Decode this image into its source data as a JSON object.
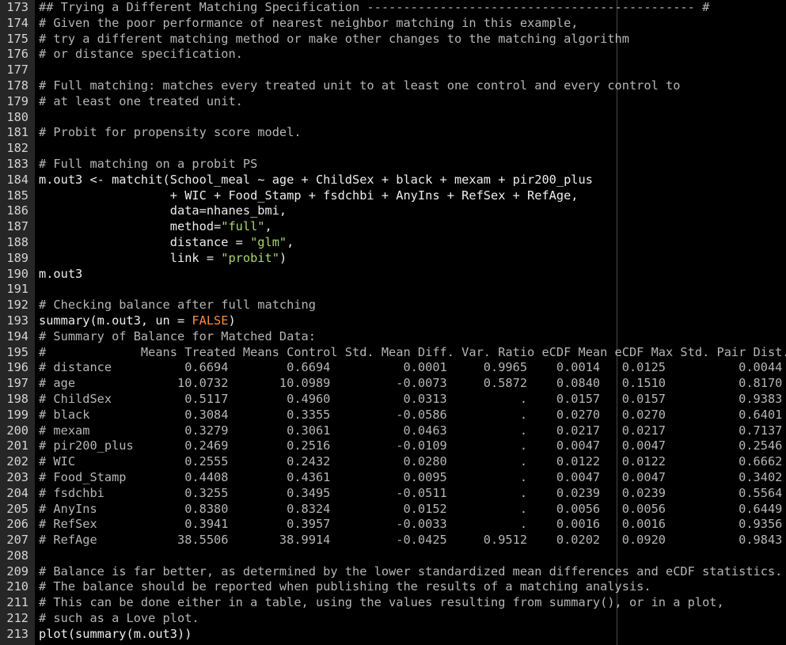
{
  "editor": {
    "colors": {
      "background": "#000000",
      "gutter": "#262626",
      "comment": "#b5b5b5",
      "string": "#a8d86e",
      "constant": "#ff8a3d",
      "text": "#ececec"
    },
    "lines": [
      {
        "n": "173",
        "segments": [
          {
            "t": "## Trying a Different Matching Specification --------------------------------------------- #",
            "c": "cmt"
          }
        ]
      },
      {
        "n": "174",
        "segments": [
          {
            "t": "# Given the poor performance of nearest neighbor matching in this example,",
            "c": "cmt"
          }
        ]
      },
      {
        "n": "175",
        "segments": [
          {
            "t": "# try a different matching method or make other changes to the matching algorithm",
            "c": "cmt"
          }
        ]
      },
      {
        "n": "176",
        "segments": [
          {
            "t": "# or distance specification.",
            "c": "cmt"
          }
        ]
      },
      {
        "n": "177",
        "segments": []
      },
      {
        "n": "178",
        "segments": [
          {
            "t": "# Full matching: matches every treated unit to at least one control and every control to",
            "c": "cmt"
          }
        ]
      },
      {
        "n": "179",
        "segments": [
          {
            "t": "# at least one treated unit.",
            "c": "cmt"
          }
        ]
      },
      {
        "n": "180",
        "segments": []
      },
      {
        "n": "181",
        "segments": [
          {
            "t": "# Probit for propensity score model.",
            "c": "cmt"
          }
        ]
      },
      {
        "n": "182",
        "segments": []
      },
      {
        "n": "183",
        "segments": [
          {
            "t": "# Full matching on a probit PS",
            "c": "cmt"
          }
        ]
      },
      {
        "n": "184",
        "segments": [
          {
            "t": "m.out3 <- matchit(School_meal ~ age + ChildSex + black + mexam + pir200_plus",
            "c": "txt"
          }
        ]
      },
      {
        "n": "185",
        "segments": [
          {
            "t": "                  + WIC + Food_Stamp + fsdchbi + AnyIns + RefSex + RefAge,",
            "c": "txt"
          }
        ]
      },
      {
        "n": "186",
        "segments": [
          {
            "t": "                  data=nhanes_bmi,",
            "c": "txt"
          }
        ]
      },
      {
        "n": "187",
        "segments": [
          {
            "t": "                  method=",
            "c": "txt"
          },
          {
            "t": "\"full\"",
            "c": "str"
          },
          {
            "t": ",",
            "c": "txt"
          }
        ]
      },
      {
        "n": "188",
        "segments": [
          {
            "t": "                  distance = ",
            "c": "txt"
          },
          {
            "t": "\"glm\"",
            "c": "str"
          },
          {
            "t": ",",
            "c": "txt"
          }
        ]
      },
      {
        "n": "189",
        "segments": [
          {
            "t": "                  link = ",
            "c": "txt"
          },
          {
            "t": "\"probit\"",
            "c": "str"
          },
          {
            "t": ")",
            "c": "txt"
          }
        ]
      },
      {
        "n": "190",
        "segments": [
          {
            "t": "m.out3",
            "c": "txt"
          }
        ]
      },
      {
        "n": "191",
        "segments": []
      },
      {
        "n": "192",
        "segments": [
          {
            "t": "# Checking balance after full matching",
            "c": "cmt"
          }
        ]
      },
      {
        "n": "193",
        "segments": [
          {
            "t": "summary(m.out3, un = ",
            "c": "txt"
          },
          {
            "t": "FALSE",
            "c": "kw"
          },
          {
            "t": ")",
            "c": "txt"
          }
        ]
      },
      {
        "n": "194",
        "segments": [
          {
            "t": "# Summary of Balance for Matched Data:",
            "c": "cmt"
          }
        ]
      },
      {
        "n": "195",
        "segments": [
          {
            "t": "#             Means Treated Means Control Std. Mean Diff. Var. Ratio eCDF Mean eCDF Max Std. Pair Dist.",
            "c": "cmt"
          }
        ]
      },
      {
        "n": "196",
        "segments": [
          {
            "t": "# distance          0.6694        0.6694          0.0001     0.9965    0.0014   0.0125          0.0044",
            "c": "cmt"
          }
        ]
      },
      {
        "n": "197",
        "segments": [
          {
            "t": "# age              10.0732       10.0989         -0.0073     0.5872    0.0840   0.1510          0.8170",
            "c": "cmt"
          }
        ]
      },
      {
        "n": "198",
        "segments": [
          {
            "t": "# ChildSex          0.5117        0.4960          0.0313          .    0.0157   0.0157          0.9383",
            "c": "cmt"
          }
        ]
      },
      {
        "n": "199",
        "segments": [
          {
            "t": "# black             0.3084        0.3355         -0.0586          .    0.0270   0.0270          0.6401",
            "c": "cmt"
          }
        ]
      },
      {
        "n": "200",
        "segments": [
          {
            "t": "# mexam             0.3279        0.3061          0.0463          .    0.0217   0.0217          0.7137",
            "c": "cmt"
          }
        ]
      },
      {
        "n": "201",
        "segments": [
          {
            "t": "# pir200_plus       0.2469        0.2516         -0.0109          .    0.0047   0.0047          0.2546",
            "c": "cmt"
          }
        ]
      },
      {
        "n": "202",
        "segments": [
          {
            "t": "# WIC               0.2555        0.2432          0.0280          .    0.0122   0.0122          0.6662",
            "c": "cmt"
          }
        ]
      },
      {
        "n": "203",
        "segments": [
          {
            "t": "# Food_Stamp        0.4408        0.4361          0.0095          .    0.0047   0.0047          0.3402",
            "c": "cmt"
          }
        ]
      },
      {
        "n": "204",
        "segments": [
          {
            "t": "# fsdchbi           0.3255        0.3495         -0.0511          .    0.0239   0.0239          0.5564",
            "c": "cmt"
          }
        ]
      },
      {
        "n": "205",
        "segments": [
          {
            "t": "# AnyIns            0.8380        0.8324          0.0152          .    0.0056   0.0056          0.6449",
            "c": "cmt"
          }
        ]
      },
      {
        "n": "206",
        "segments": [
          {
            "t": "# RefSex            0.3941        0.3957         -0.0033          .    0.0016   0.0016          0.9356",
            "c": "cmt"
          }
        ]
      },
      {
        "n": "207",
        "segments": [
          {
            "t": "# RefAge           38.5506       38.9914         -0.0425     0.9512    0.0202   0.0920          0.9843",
            "c": "cmt"
          }
        ]
      },
      {
        "n": "208",
        "segments": []
      },
      {
        "n": "209",
        "segments": [
          {
            "t": "# Balance is far better, as determined by the lower standardized mean differences and eCDF statistics.",
            "c": "cmt"
          }
        ]
      },
      {
        "n": "210",
        "segments": [
          {
            "t": "# The balance should be reported when publishing the results of a matching analysis.",
            "c": "cmt"
          }
        ]
      },
      {
        "n": "211",
        "segments": [
          {
            "t": "# This can be done either in a table, using the values resulting from summary(), or in a plot,",
            "c": "cmt"
          }
        ]
      },
      {
        "n": "212",
        "segments": [
          {
            "t": "# such as a Love plot.",
            "c": "cmt"
          }
        ]
      },
      {
        "n": "213",
        "segments": [
          {
            "t": "plot(summary(m.out3))",
            "c": "txt"
          }
        ]
      }
    ]
  }
}
